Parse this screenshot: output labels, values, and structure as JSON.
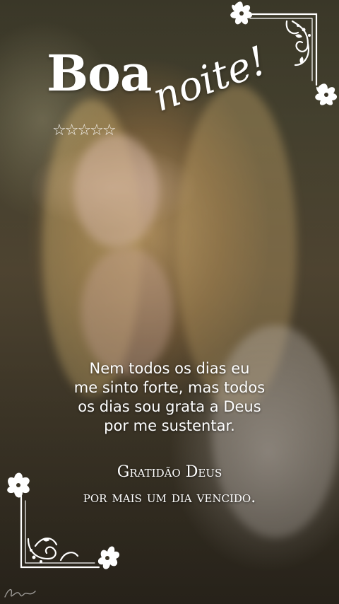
{
  "greeting": {
    "word1": "Boa",
    "word2": "noite!",
    "stars": "☆☆☆☆☆",
    "star_count": 5
  },
  "message": {
    "lines": [
      "Nem todos os dias eu",
      "me sinto forte, mas todos",
      "os dias sou grata a Deus",
      "por me sustentar."
    ]
  },
  "gratitude": {
    "lines": [
      "Gratidão Deus",
      "por mais um dia vencido."
    ]
  },
  "colors": {
    "text": "#ffffff",
    "ornament": "#ffffff"
  },
  "icons": {
    "top_right": "floral-corner-ornament",
    "bottom_left": "floral-corner-ornament",
    "signature": "artist-signature"
  }
}
